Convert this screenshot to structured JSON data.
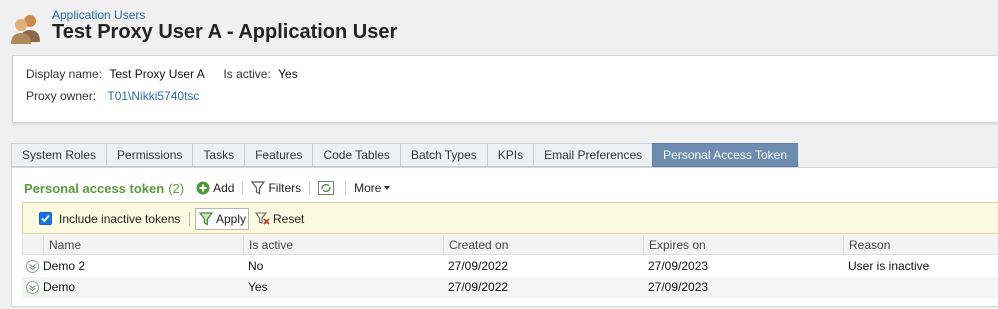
{
  "header": {
    "breadcrumb": "Application Users",
    "title": "Test Proxy User A - Application User"
  },
  "info": {
    "display_name_label": "Display name:",
    "display_name_value": "Test Proxy User A",
    "is_active_label": "Is active:",
    "is_active_value": "Yes",
    "proxy_owner_label": "Proxy owner:",
    "proxy_owner_value": "T01\\Nikki5740tsc"
  },
  "tabs": [
    {
      "label": "System Roles"
    },
    {
      "label": "Permissions"
    },
    {
      "label": "Tasks"
    },
    {
      "label": "Features"
    },
    {
      "label": "Code Tables"
    },
    {
      "label": "Batch Types"
    },
    {
      "label": "KPIs"
    },
    {
      "label": "Email Preferences"
    },
    {
      "label": "Personal Access Token",
      "active": true
    }
  ],
  "panel": {
    "title": "Personal access token",
    "count": "(2)",
    "add_label": "Add",
    "filters_label": "Filters",
    "more_label": "More",
    "accent_color": "#5a9a3c"
  },
  "filter": {
    "include_inactive_label": "Include inactive tokens",
    "include_inactive_checked": true,
    "apply_label": "Apply",
    "reset_label": "Reset"
  },
  "grid": {
    "columns": [
      "Name",
      "Is active",
      "Created on",
      "Expires on",
      "Reason"
    ],
    "rows": [
      {
        "name": "Demo 2",
        "is_active": "No",
        "created_on": "27/09/2022",
        "expires_on": "27/09/2023",
        "reason": "User is inactive"
      },
      {
        "name": "Demo",
        "is_active": "Yes",
        "created_on": "27/09/2022",
        "expires_on": "27/09/2023",
        "reason": ""
      }
    ]
  }
}
